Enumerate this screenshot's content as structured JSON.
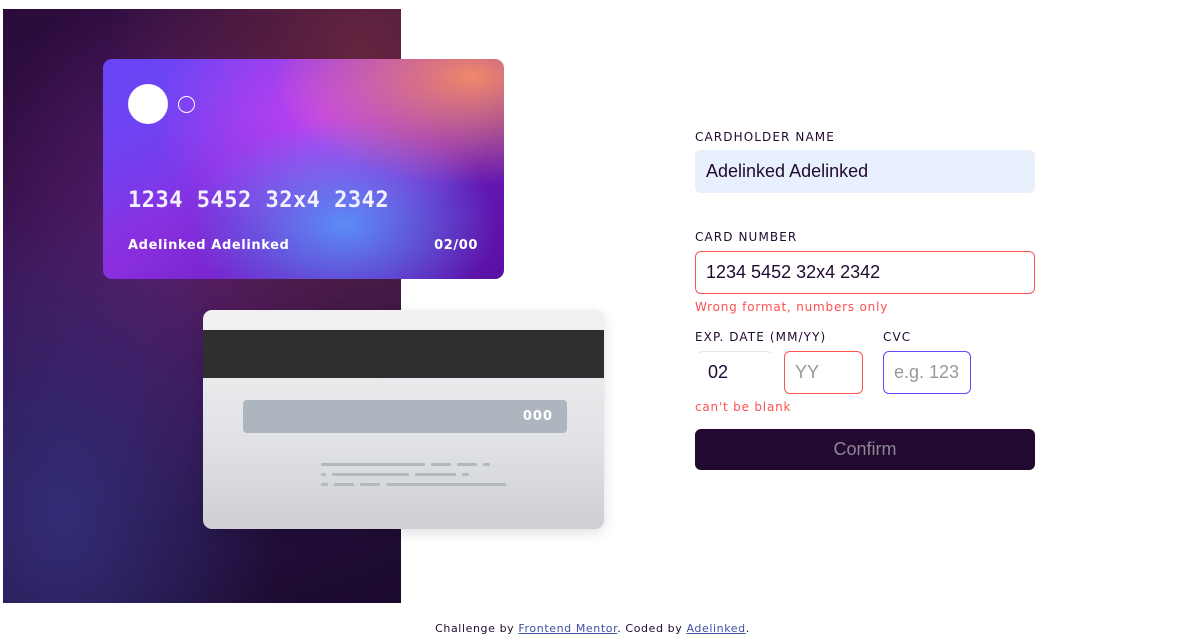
{
  "card_front": {
    "number": "1234 5452 32x4 2342",
    "name": "Adelinked Adelinked",
    "expiry": "02/00"
  },
  "card_back": {
    "cvc": "000"
  },
  "form": {
    "cardholder_label": "CARDHOLDER NAME",
    "cardholder_value": "Adelinked Adelinked",
    "card_number_label": "CARD NUMBER",
    "card_number_value": "1234 5452 32x4 2342",
    "card_number_error": "Wrong format, numbers only",
    "exp_label": "EXP. DATE (MM/YY)",
    "exp_month_value": "02",
    "exp_year_placeholder": "YY",
    "exp_error": "can't be blank",
    "cvc_label": "CVC",
    "cvc_placeholder": "e.g. 123",
    "confirm_label": "Confirm"
  },
  "footer": {
    "prefix": "Challenge by",
    "frontend_mentor_link": "Frontend Mentor",
    "middle": ". Coded by",
    "author_link": "Adelinked",
    "suffix": "."
  },
  "colors": {
    "dark_violet": "#21092f",
    "error_red": "#ff5050",
    "focus_violet": "#6348fe"
  }
}
